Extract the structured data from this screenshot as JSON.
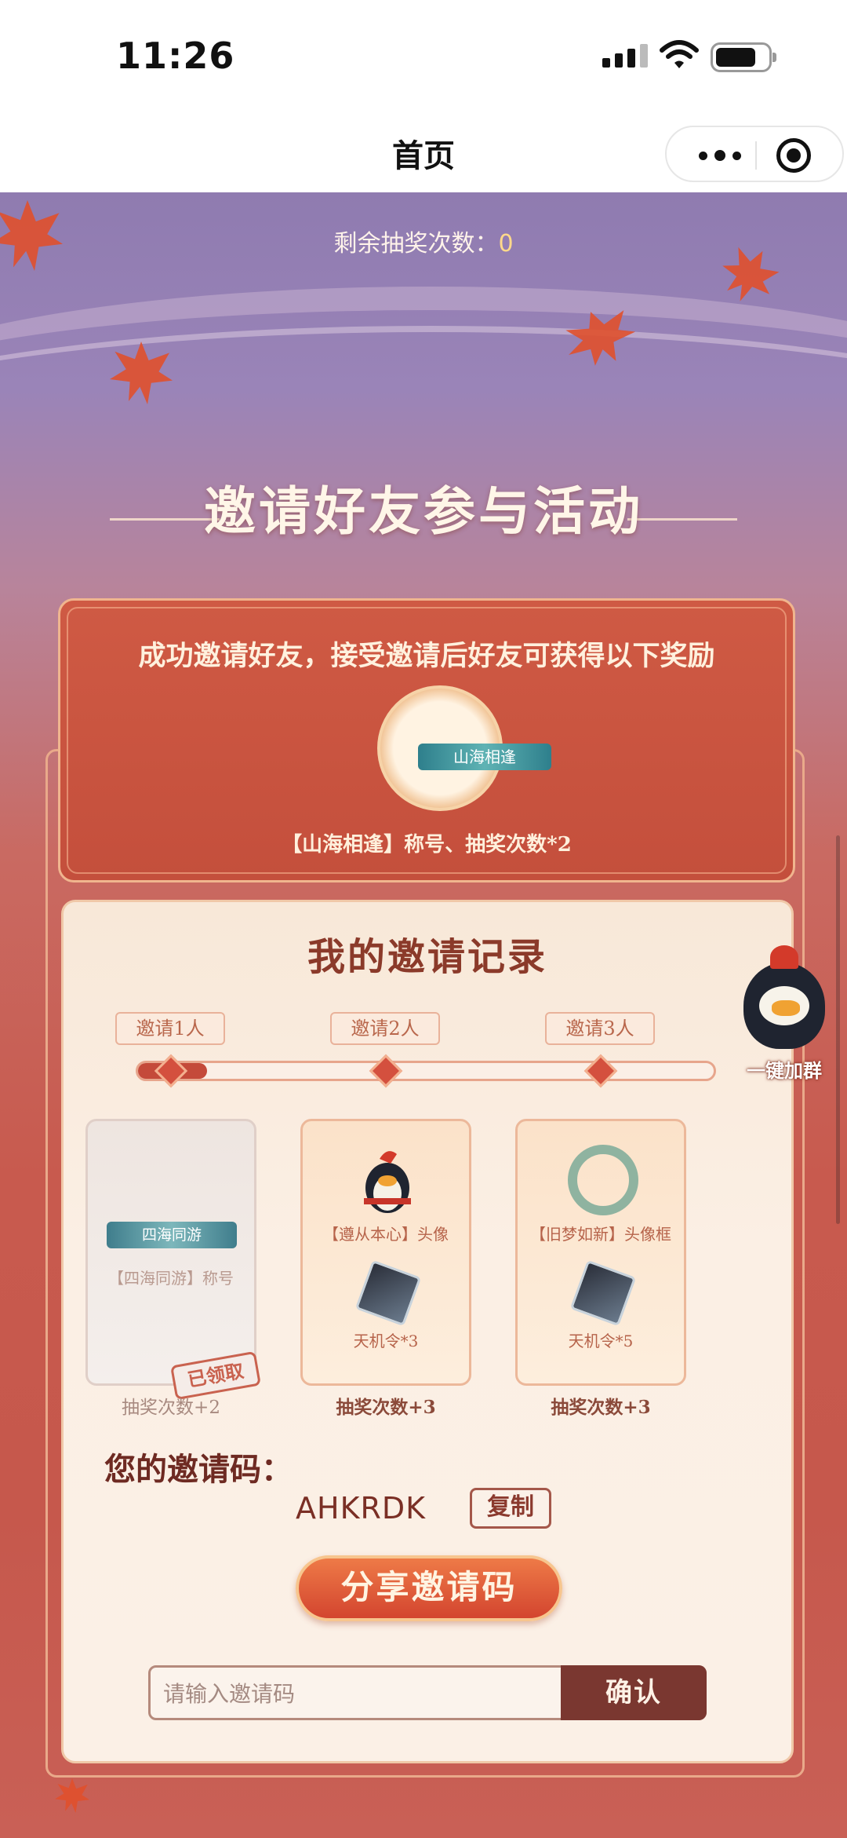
{
  "status_bar": {
    "time": "11:26"
  },
  "nav": {
    "title": "首页"
  },
  "lottery": {
    "label": "剩余抽奖次数：",
    "count": "0"
  },
  "section_title": "邀请好友参与活动",
  "reward_card": {
    "title": "成功邀请好友，接受邀请后好友可获得以下奖励",
    "badge_text": "山海相逢",
    "description": "【山海相逢】称号、抽奖次数*2"
  },
  "records": {
    "title": "我的邀请记录",
    "progress_fraction": 0.12,
    "steps": [
      {
        "tag": "邀请1人",
        "items": [
          "四海同游",
          "【四海同游】称号"
        ],
        "stamp": "已领取",
        "bonus": "抽奖次数+2",
        "claimed": true
      },
      {
        "tag": "邀请2人",
        "items": [
          "【遵从本心】头像",
          "天机令*3"
        ],
        "bonus": "抽奖次数+3",
        "claimed": false
      },
      {
        "tag": "邀请3人",
        "items": [
          "【旧梦如新】头像框",
          "天机令*5"
        ],
        "bonus": "抽奖次数+3",
        "claimed": false
      }
    ]
  },
  "invite_code": {
    "label": "您的邀请码：",
    "code": "AHKRDK",
    "copy_label": "复制",
    "share_label": "分享邀请码"
  },
  "code_input": {
    "placeholder": "请输入邀请码",
    "confirm_label": "确认"
  },
  "mascot": {
    "label": "一键加群"
  },
  "colors": {
    "accent": "#c44a3a",
    "dark_button": "#7a3730",
    "share_button": "#e0603a"
  }
}
